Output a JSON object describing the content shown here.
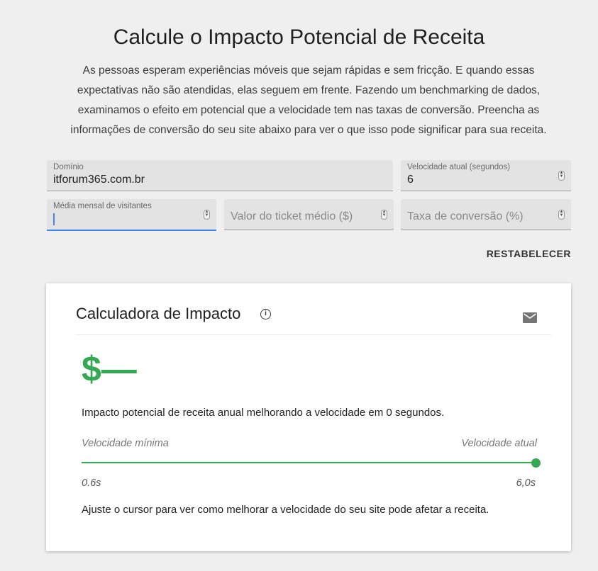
{
  "header": {
    "title": "Calcule o Impacto Potencial de Receita",
    "intro": "As pessoas esperam experiências móveis que sejam rápidas e sem fricção. E quando essas expectativas não são atendidas, elas seguem em frente. Fazendo um benchmarking de dados, examinamos o efeito em potencial que a velocidade tem nas taxas de conversão. Preencha as informações de conversão do seu site abaixo para ver o que isso pode significar para sua receita."
  },
  "form": {
    "domain": {
      "label": "Domínio",
      "value": "itforum365.com.br"
    },
    "speed": {
      "label": "Velocidade atual (segundos)",
      "value": "6"
    },
    "visitors": {
      "label": "Média mensal de visitantes",
      "value": ""
    },
    "ticket": {
      "placeholder": "Valor do ticket médio ($)"
    },
    "conversion": {
      "placeholder": "Taxa de conversão (%)"
    },
    "reset_label": "RESTABELECER"
  },
  "card": {
    "title": "Calculadora de Impacto",
    "info_icon": "i",
    "value": "$—",
    "description": "Impacto potencial de receita anual melhorando a velocidade em 0 segundos.",
    "min_label": "Velocidade mínima",
    "current_label": "Velocidade atual",
    "min_value": "0.6s",
    "current_value": "6,0s",
    "slider_fraction": 1.0,
    "hint": "Ajuste o cursor para ver como melhorar a velocidade do seu site pode afetar a receita.",
    "accent_color": "#34a853",
    "icons": {
      "info": "info-icon",
      "mail": "mail-icon"
    }
  }
}
